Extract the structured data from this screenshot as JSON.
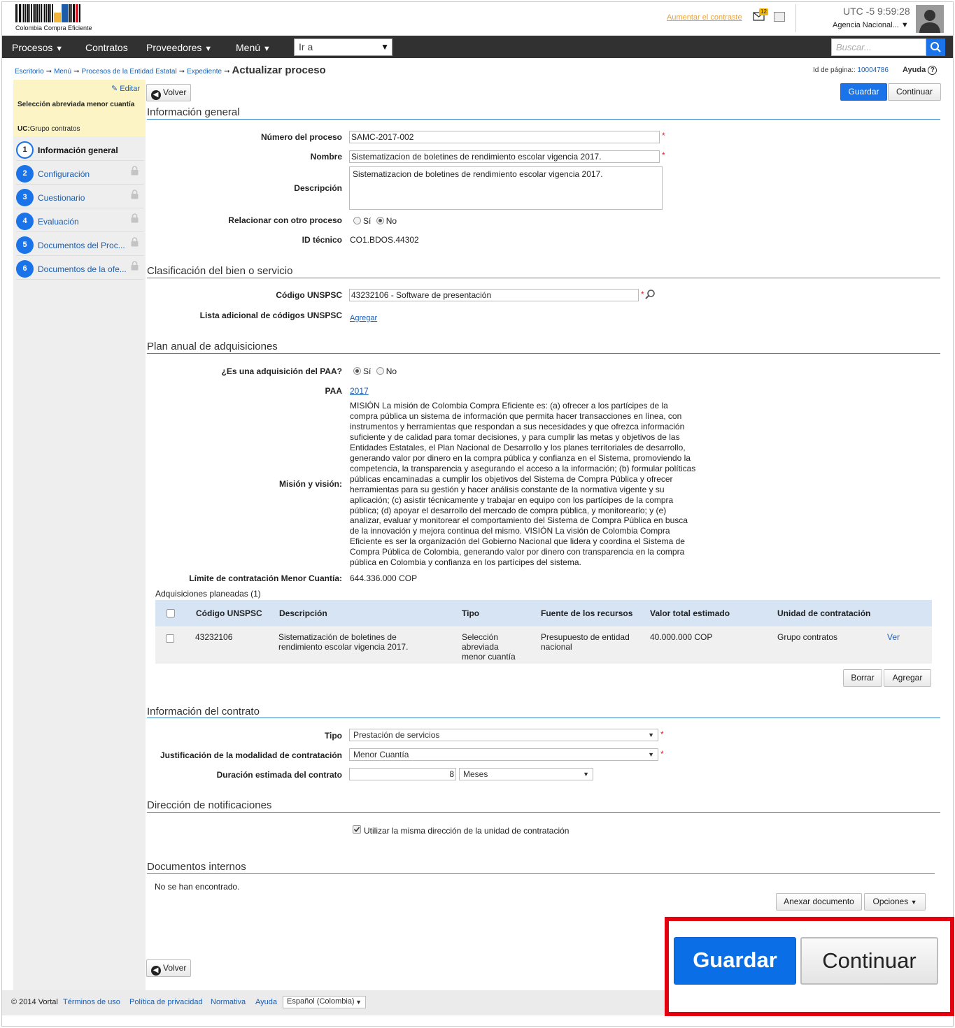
{
  "header": {
    "logo_text": "Colombia Compra Eficiente",
    "contrast_link": "Aumentar el contraste",
    "mail_count": "12",
    "clock": "UTC -5 9:59:28",
    "agency": "Agencia Nacional..."
  },
  "nav": {
    "items": [
      "Procesos",
      "Contratos",
      "Proveedores",
      "Menú"
    ],
    "goto_label": "Ir a",
    "search_placeholder": "Buscar..."
  },
  "breadcrumb": {
    "items": [
      "Escritorio",
      "Menú",
      "Procesos de la Entidad Estatal",
      "Expediente"
    ],
    "current": "Actualizar proceso",
    "page_id_label": "Id de página::",
    "page_id": "10004786",
    "help": "Ayuda"
  },
  "sidebar": {
    "edit": "Editar",
    "title": "Selección abreviada menor cuantía",
    "uc_label": "UC:",
    "uc_value": "Grupo contratos",
    "steps": [
      {
        "num": "1",
        "label": "Información general"
      },
      {
        "num": "2",
        "label": "Configuración"
      },
      {
        "num": "3",
        "label": "Cuestionario"
      },
      {
        "num": "4",
        "label": "Evaluación"
      },
      {
        "num": "5",
        "label": "Documentos del Proc..."
      },
      {
        "num": "6",
        "label": "Documentos de la ofe..."
      }
    ]
  },
  "actions": {
    "back": "Volver",
    "save": "Guardar",
    "continue": "Continuar"
  },
  "general": {
    "title": "Información general",
    "numero_label": "Número del proceso",
    "numero_value": "SAMC-2017-002",
    "nombre_label": "Nombre",
    "nombre_value": "Sistematizacion de boletines de rendimiento escolar vigencia 2017.",
    "descripcion_label": "Descripción",
    "descripcion_value": "Sistematizacion de boletines de rendimiento escolar vigencia 2017.",
    "relacionar_label": "Relacionar con otro proceso",
    "yes": "Sí",
    "no": "No",
    "relacionar_selected": "No",
    "id_label": "ID técnico",
    "id_value": "CO1.BDOS.44302"
  },
  "clasificacion": {
    "title": "Clasificación del bien o servicio",
    "unspsc_label": "Código UNSPSC",
    "unspsc_value": "43232106 - Software de presentación",
    "lista_label": "Lista adicional de códigos UNSPSC",
    "lista_link": "Agregar"
  },
  "paa": {
    "title": "Plan anual de adquisiciones",
    "es_label": "¿Es una adquisición del PAA?",
    "es_selected": "Sí",
    "paa_label": "PAA",
    "paa_value": "2017",
    "mision_label": "Misión y visión:",
    "mision_text": "MISIÓN La misión de Colombia Compra Eficiente es: (a) ofrecer a los partícipes de la compra pública un sistema de información que permita hacer transacciones en línea, con instrumentos y herramientas que respondan a sus necesidades y que ofrezca información suficiente y de calidad para tomar decisiones, y para cumplir las metas y objetivos de las Entidades Estatales, el Plan Nacional de Desarrollo y los planes territoriales de desarrollo, generando valor por dinero en la compra pública y confianza en el Sistema, promoviendo la competencia, la transparencia y asegurando el acceso a la información; (b) formular políticas públicas encaminadas a cumplir los objetivos del Sistema de Compra Pública y ofrecer herramientas para su gestión y hacer análisis constante de la normativa vigente y su aplicación; (c) asistir técnicamente y trabajar en equipo con los partícipes de la compra pública; (d) apoyar el desarrollo del mercado de compra pública, y monitorearlo; y (e) analizar, evaluar y monitorear el comportamiento del Sistema de Compra Pública en busca de la innovación y mejora continua del mismo. VISIÓN La visión de Colombia Compra Eficiente es ser la organización del Gobierno Nacional que lidera y coordina el Sistema de Compra Pública de Colombia, generando valor por dinero con transparencia en la compra pública en Colombia y confianza en los partícipes del sistema.",
    "limite_label": "Límite de contratación Menor Cuantía:",
    "limite_value": "644.336.000 COP",
    "planeadas_label": "Adquisiciones planeadas (1)",
    "table": {
      "headers": [
        "Código UNSPSC",
        "Descripción",
        "Tipo",
        "Fuente de los recursos",
        "Valor total estimado",
        "Unidad de contratación"
      ],
      "rows": [
        {
          "codigo": "43232106",
          "descripcion": "Sistematización de boletines de rendimiento escolar vigencia 2017.",
          "tipo": "Selección abreviada menor cuantía",
          "fuente": "Presupuesto de entidad nacional",
          "valor": "40.000.000 COP",
          "unidad": "Grupo contratos",
          "ver": "Ver"
        }
      ]
    },
    "borrar": "Borrar",
    "agregar": "Agregar"
  },
  "contrato": {
    "title": "Información del contrato",
    "tipo_label": "Tipo",
    "tipo_value": "Prestación de servicios",
    "justificacion_label": "Justificación de la modalidad de contratación",
    "justificacion_value": "Menor Cuantía",
    "duracion_label": "Duración estimada del contrato",
    "duracion_value": "8",
    "duracion_unit": "Meses"
  },
  "notificaciones": {
    "title": "Dirección de notificaciones",
    "checkbox_label": "Utilizar la misma dirección de la unidad de contratación",
    "checked": true
  },
  "documentos": {
    "title": "Documentos internos",
    "empty": "No se han encontrado.",
    "anexar": "Anexar documento",
    "opciones": "Opciones"
  },
  "footer": {
    "copyright": "© 2014 Vortal",
    "links": [
      "Términos de uso",
      "Política de privacidad",
      "Normativa",
      "Ayuda"
    ],
    "language": "Español (Colombia)"
  },
  "highlight": {
    "save": "Guardar",
    "continue": "Continuar",
    "color": "#e3000f"
  },
  "colors": {
    "primary": "#1a73e8",
    "nav_bg": "#313131",
    "section_rule": "#3b86c8",
    "sidebar_note": "#fcf4c5"
  }
}
